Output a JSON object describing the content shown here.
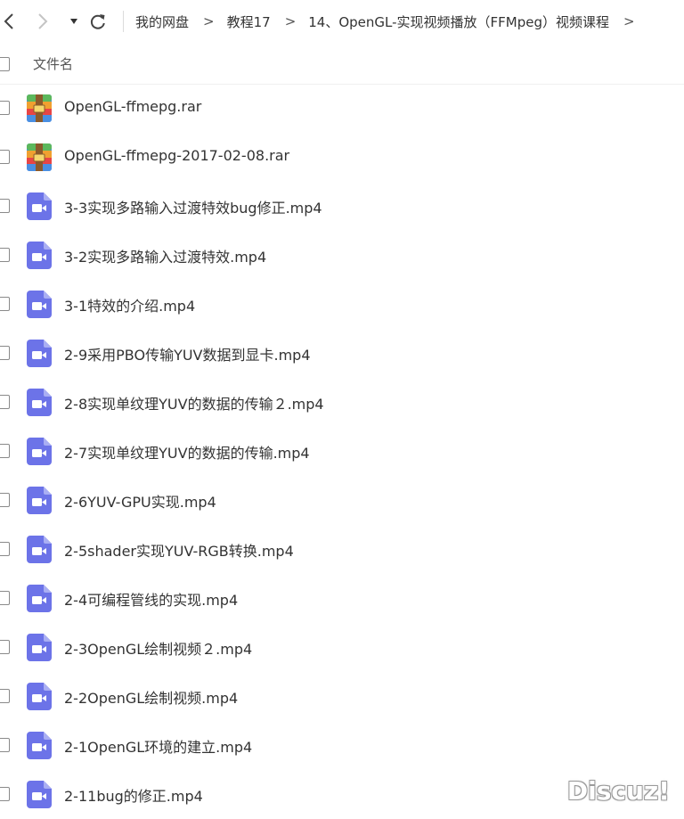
{
  "toolbar": {
    "back_icon": "chevron-left-icon",
    "forward_icon": "chevron-right-icon",
    "dropdown_icon": "caret-down-icon",
    "refresh_icon": "refresh-icon"
  },
  "breadcrumb": {
    "items": [
      "我的网盘",
      "教程17",
      "14、OpenGL-实现视频播放（FFMpeg）视频课程"
    ],
    "separator": ">"
  },
  "header": {
    "column_label": "文件名"
  },
  "files": [
    {
      "name": "OpenGL-ffmepg.rar",
      "type": "archive"
    },
    {
      "name": "OpenGL-ffmepg-2017-02-08.rar",
      "type": "archive"
    },
    {
      "name": "3-3实现多路输入过渡特效bug修正.mp4",
      "type": "video"
    },
    {
      "name": "3-2实现多路输入过渡特效.mp4",
      "type": "video"
    },
    {
      "name": "3-1特效的介绍.mp4",
      "type": "video"
    },
    {
      "name": "2-9采用PBO传输YUV数据到显卡.mp4",
      "type": "video"
    },
    {
      "name": "2-8实现单纹理YUV的数据的传输２.mp4",
      "type": "video"
    },
    {
      "name": "2-7实现单纹理YUV的数据的传输.mp4",
      "type": "video"
    },
    {
      "name": "2-6YUV-GPU实现.mp4",
      "type": "video"
    },
    {
      "name": "2-5shader实现YUV-RGB转换.mp4",
      "type": "video"
    },
    {
      "name": "2-4可编程管线的实现.mp4",
      "type": "video"
    },
    {
      "name": "2-3OpenGL绘制视频２.mp4",
      "type": "video"
    },
    {
      "name": "2-2OpenGL绘制视频.mp4",
      "type": "video"
    },
    {
      "name": "2-1OpenGL环境的建立.mp4",
      "type": "video"
    },
    {
      "name": "2-11bug的修正.mp4",
      "type": "video"
    }
  ],
  "colors": {
    "video_icon": "#6C73E8",
    "archive_blue": "#4A8FE2",
    "archive_orange": "#F0A030",
    "archive_red": "#E84545",
    "archive_green": "#5CB85C"
  },
  "watermark": "Discuz!"
}
